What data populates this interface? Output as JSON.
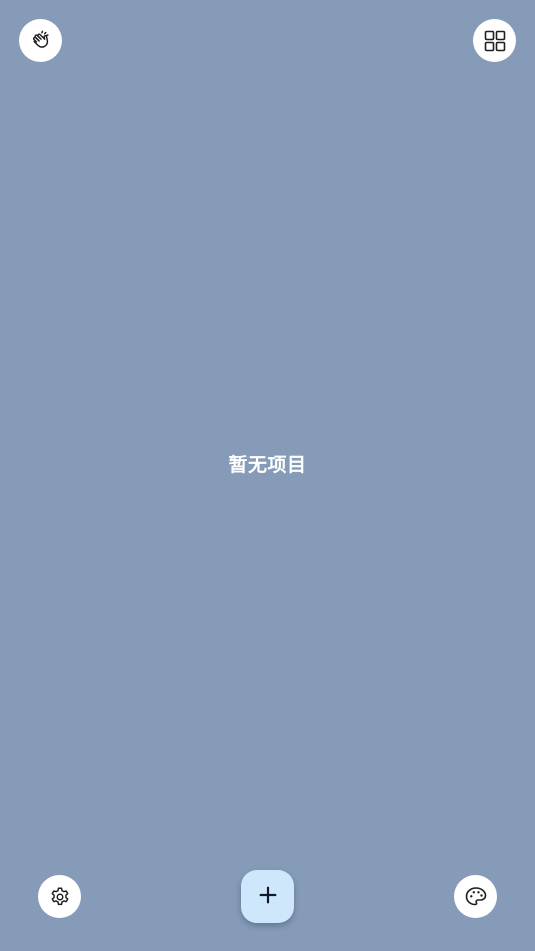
{
  "screen": {
    "background": "#869bb8",
    "empty_text": "暂无项目"
  },
  "top_left_button": {
    "icon": "clap-icon"
  },
  "top_right_button": {
    "icon": "grid-view-icon"
  },
  "bottom_left_button": {
    "icon": "gear-icon"
  },
  "bottom_right_button": {
    "icon": "palette-icon"
  },
  "fab": {
    "icon": "plus-icon",
    "color": "#cfe7fb"
  }
}
